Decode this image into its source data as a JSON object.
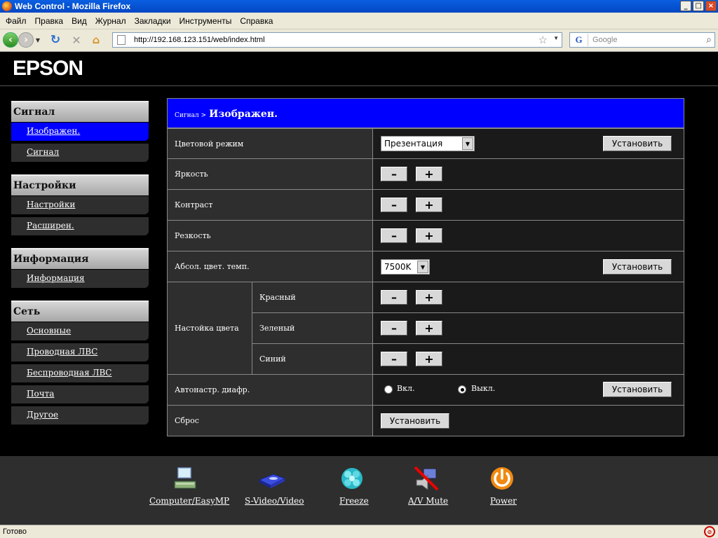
{
  "window": {
    "title": "Web Control - Mozilla Firefox",
    "buttons": [
      "_",
      "□",
      "×"
    ]
  },
  "menu": [
    "Файл",
    "Правка",
    "Вид",
    "Журнал",
    "Закладки",
    "Инструменты",
    "Справка"
  ],
  "nav": {
    "url": "http://192.168.123.151/web/index.html",
    "search_placeholder": "Google",
    "search_engine_letter": "G"
  },
  "logo": "EPSON",
  "sidebar": {
    "sections": [
      {
        "title": "Сигнал",
        "items": [
          "Изображен.",
          "Сигнал"
        ]
      },
      {
        "title": "Настройки",
        "items": [
          "Настройки",
          "Расширен."
        ]
      },
      {
        "title": "Информация",
        "items": [
          "Информация"
        ]
      },
      {
        "title": "Сеть",
        "items": [
          "Основные",
          "Проводная ЛВС",
          "Беспроводная ЛВС",
          "Почта",
          "Другое"
        ]
      }
    ],
    "active_item": "Изображен."
  },
  "panel": {
    "breadcrumb": "Сигнал >",
    "title": "Изображен.",
    "rows": {
      "color_mode": {
        "label": "Цветовой режим",
        "value": "Презентация",
        "button": "Установить"
      },
      "brightness": {
        "label": "Яркость"
      },
      "contrast": {
        "label": "Контраст"
      },
      "sharpness": {
        "label": "Резкость"
      },
      "color_temp": {
        "label": "Абсол. цвет. темп.",
        "value": "7500K",
        "button": "Установить"
      },
      "color_adjust": {
        "label": "Настойка цвета",
        "red": "Красный",
        "green": "Зеленый",
        "blue": "Синий"
      },
      "auto_iris": {
        "label": "Автонастр. диафр.",
        "on": "Вкл.",
        "off": "Выкл.",
        "selected": "Выкл.",
        "button": "Установить"
      },
      "reset": {
        "label": "Сброс",
        "button": "Установить"
      }
    },
    "minus": "–",
    "plus": "+"
  },
  "bottom_bar": [
    {
      "label": "Computer/EasyMP",
      "icon": "computer-icon"
    },
    {
      "label": "S-Video/Video",
      "icon": "video-device-icon"
    },
    {
      "label": "Freeze",
      "icon": "freeze-icon"
    },
    {
      "label": "A/V Mute",
      "icon": "av-mute-icon"
    },
    {
      "label": "Power",
      "icon": "power-icon"
    }
  ],
  "status": "Готово"
}
